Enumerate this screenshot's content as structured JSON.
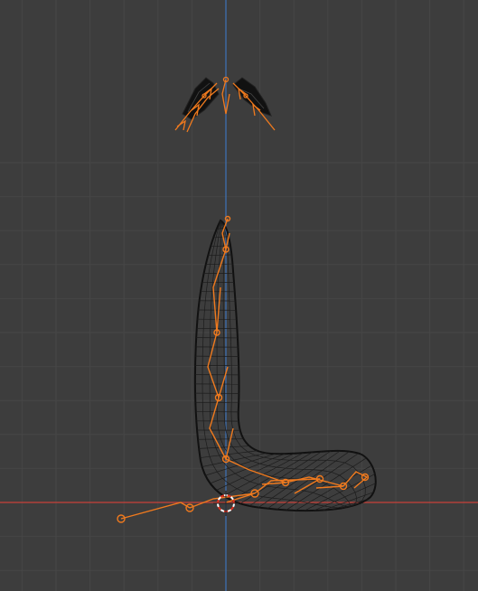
{
  "viewport": {
    "mode": "front-orthographic",
    "background_color": "#3d3d3d",
    "grid_minor_color": "#464646",
    "grid_major_color": "#4f4f4f",
    "x_axis_color": "#c8413a",
    "z_axis_color": "#3e6fb0"
  },
  "scene": {
    "mesh": {
      "name": "tail-mesh",
      "display": "wireframe",
      "color": "#111111"
    },
    "armature": {
      "name": "armature",
      "display": "octahedral",
      "selection_color": "#f07a1e"
    },
    "ears": {
      "left": "left-ear-mesh",
      "right": "right-ear-mesh",
      "color": "#111111"
    },
    "cursor": {
      "name": "3d-cursor-icon",
      "color_a": "#ffffff",
      "color_b": "#e0301f"
    }
  }
}
